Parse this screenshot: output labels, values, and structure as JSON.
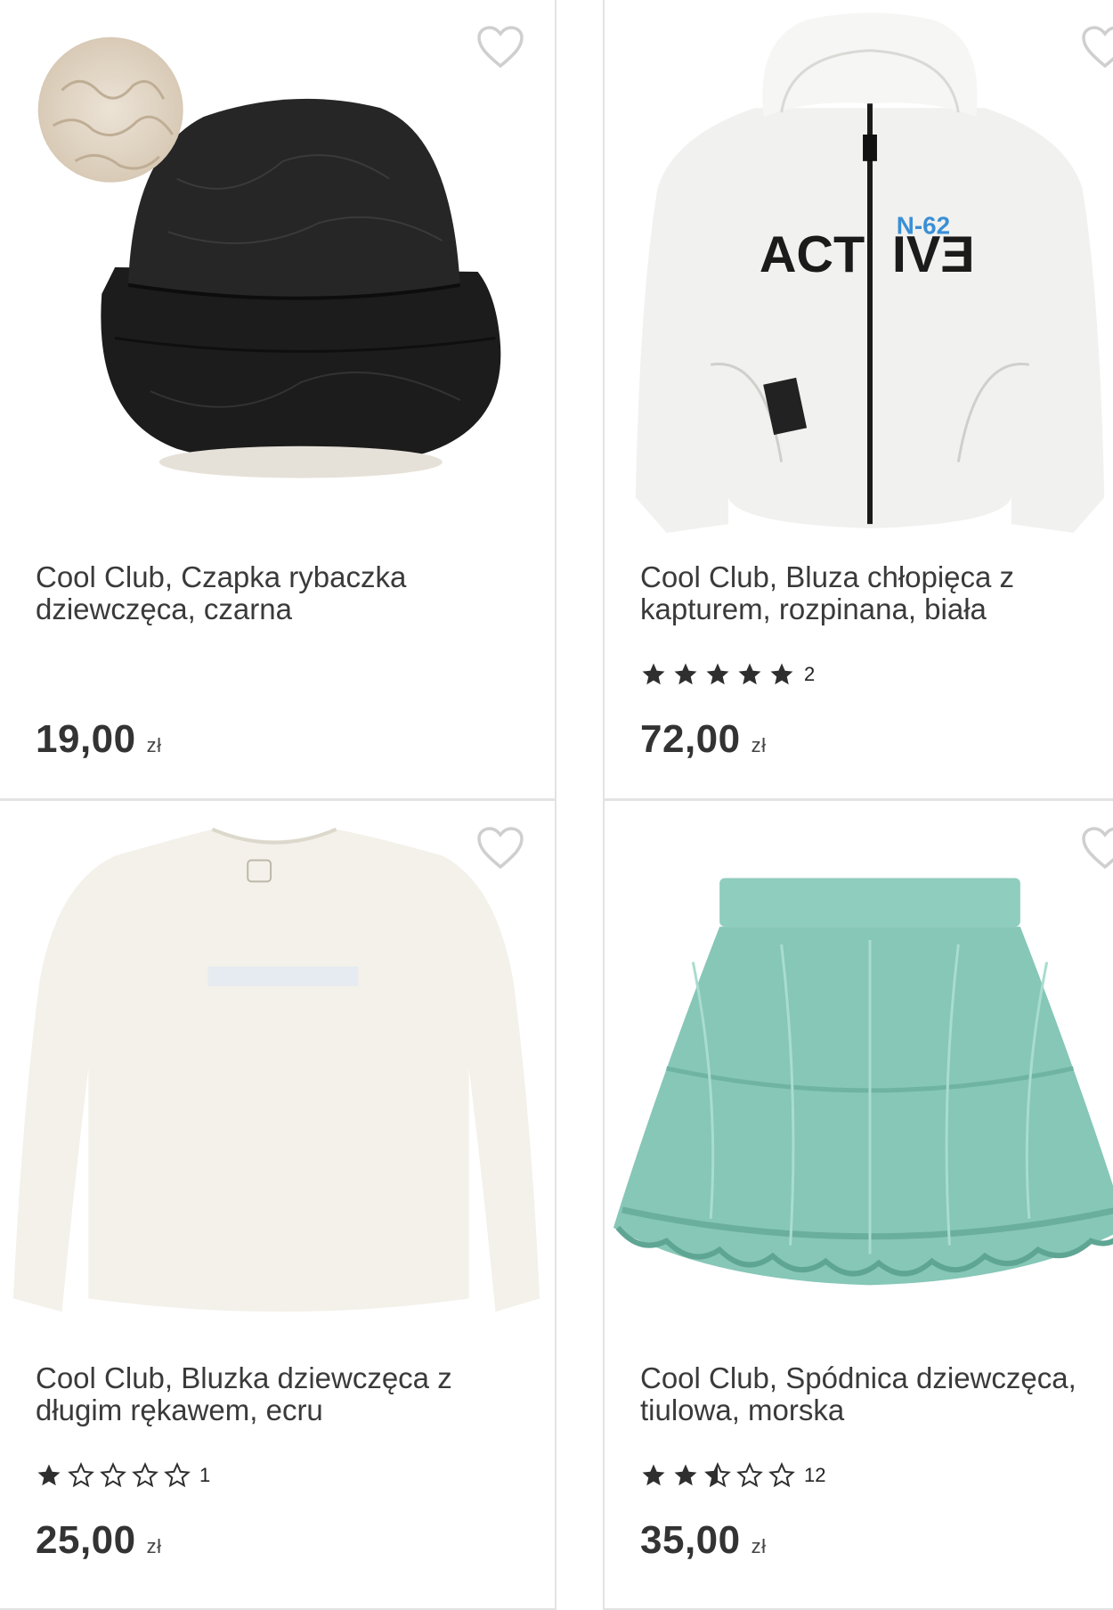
{
  "products": [
    {
      "title": "Cool Club, Czapka rybaczka dziewczęca, czarna",
      "price": "19,00",
      "currency": "zł",
      "rating": null,
      "rating_count": null
    },
    {
      "title": "Cool Club, Bluza chłopięca z kapturem, rozpinana, biała",
      "price": "72,00",
      "currency": "zł",
      "rating": 5,
      "rating_count": "2",
      "print_text": "ACT IVƎ",
      "print_badge": "N-62"
    },
    {
      "title": "Cool Club, Bluzka dziewczęca z długim rękawem, ecru",
      "price": "25,00",
      "currency": "zł",
      "rating": 1,
      "rating_count": "1"
    },
    {
      "title": "Cool Club, Spódnica dziewczęca, tiulowa, morska",
      "price": "35,00",
      "currency": "zł",
      "rating": 2.5,
      "rating_count": "12"
    }
  ],
  "icons": {
    "favorite": "heart-outline-icon",
    "star_full": "star-filled-icon",
    "star_half": "star-half-icon",
    "star_empty": "star-outline-icon"
  },
  "colors": {
    "star": "#2f2f2f",
    "heart": "#cfcfcf",
    "card_border": "#e3e3e3",
    "skirt": "#7ec4b4"
  }
}
